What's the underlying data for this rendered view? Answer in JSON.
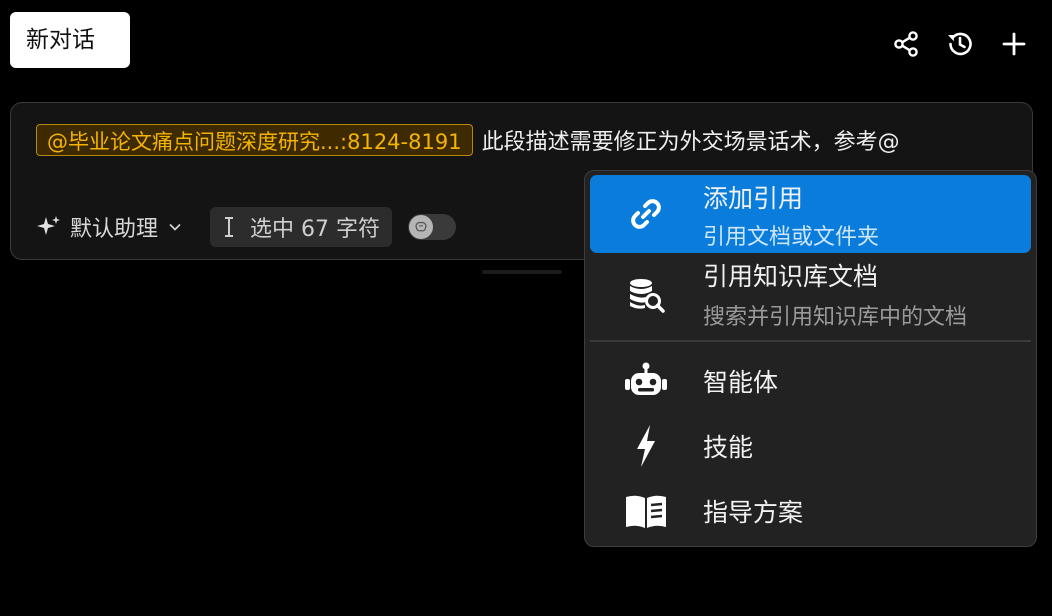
{
  "header": {
    "new_chat_label": "新对话",
    "icons": [
      "share-icon",
      "history-icon",
      "plus-icon"
    ]
  },
  "composer": {
    "mention_chip": "@毕业论文痛点问题深度研究...:8124-8191",
    "text": "此段描述需要修正为外交场景话术，参考@",
    "assistant_label": "默认助理",
    "selection_label": "选中 67 字符",
    "toggle_on": false
  },
  "menu": {
    "items": [
      {
        "title": "添加引用",
        "subtitle": "引用文档或文件夹",
        "icon": "link-icon",
        "active": true
      },
      {
        "title": "引用知识库文档",
        "subtitle": "搜索并引用知识库中的文档",
        "icon": "database-search-icon",
        "active": false
      },
      {
        "title": "智能体",
        "subtitle": "",
        "icon": "robot-icon",
        "active": false
      },
      {
        "title": "技能",
        "subtitle": "",
        "icon": "lightning-icon",
        "active": false
      },
      {
        "title": "指导方案",
        "subtitle": "",
        "icon": "book-icon",
        "active": false
      }
    ]
  },
  "colors": {
    "accent": "#0a7ddc",
    "chip_text": "#f5b400",
    "chip_border": "#b8860b",
    "background": "#000000",
    "menu_bg": "#222222"
  }
}
